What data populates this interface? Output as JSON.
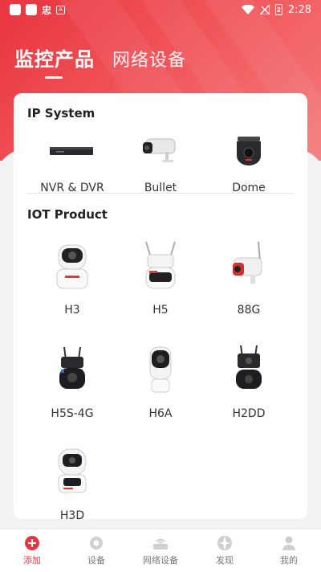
{
  "status": {
    "time": "2:28",
    "left_glyph": "忠",
    "a_glyph": "A",
    "battery_glyph": "2"
  },
  "tabs": [
    {
      "label": "监控产品",
      "active": true
    },
    {
      "label": "网络设备",
      "active": false
    }
  ],
  "sections": {
    "ip": {
      "title": "IP System",
      "items": [
        {
          "label": "NVR & DVR",
          "icon": "nvr-icon"
        },
        {
          "label": "Bullet",
          "icon": "bullet-camera-icon"
        },
        {
          "label": "Dome",
          "icon": "dome-camera-icon"
        }
      ]
    },
    "iot": {
      "title": "IOT Product",
      "items": [
        {
          "label": "H3",
          "icon": "h3-camera-icon"
        },
        {
          "label": "H5",
          "icon": "h5-camera-icon"
        },
        {
          "label": "88G",
          "icon": "88g-camera-icon"
        },
        {
          "label": "H5S-4G",
          "icon": "h5s-4g-camera-icon"
        },
        {
          "label": "H6A",
          "icon": "h6a-camera-icon"
        },
        {
          "label": "H2DD",
          "icon": "h2dd-camera-icon"
        },
        {
          "label": "H3D",
          "icon": "h3d-camera-icon"
        }
      ]
    }
  },
  "nav": [
    {
      "label": "添加",
      "icon": "plus-icon",
      "active": true
    },
    {
      "label": "设备",
      "icon": "device-icon",
      "active": false
    },
    {
      "label": "网络设备",
      "icon": "router-icon",
      "active": false
    },
    {
      "label": "发现",
      "icon": "discover-icon",
      "active": false
    },
    {
      "label": "我的",
      "icon": "profile-icon",
      "active": false
    }
  ],
  "colors": {
    "brand": "#e93540",
    "card": "#ffffff",
    "background": "#f2f2f4"
  }
}
